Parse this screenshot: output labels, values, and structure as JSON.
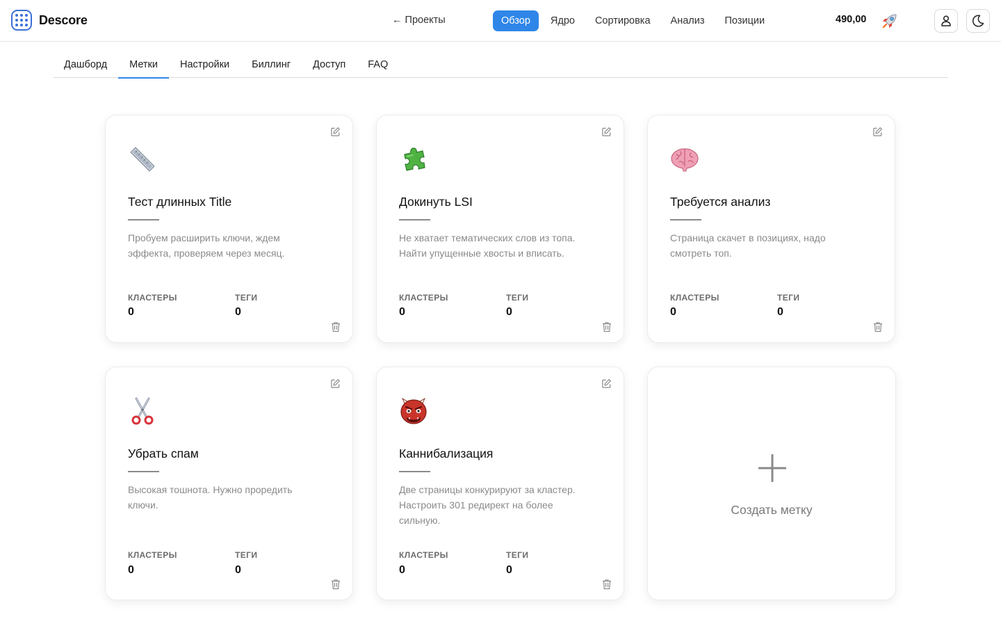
{
  "app": {
    "name": "Descore"
  },
  "header": {
    "back_label": "← Проекты",
    "nav": [
      {
        "label": "Обзор",
        "active": true
      },
      {
        "label": "Ядро",
        "active": false
      },
      {
        "label": "Сортировка",
        "active": false
      },
      {
        "label": "Анализ",
        "active": false
      },
      {
        "label": "Позиции",
        "active": false
      }
    ],
    "balance": "490,00",
    "balance_icon": "rocket-icon",
    "user_icon": "user-icon",
    "theme_icon": "moon-icon"
  },
  "tabs": [
    {
      "label": "Дашборд",
      "active": false
    },
    {
      "label": "Метки",
      "active": true
    },
    {
      "label": "Настройки",
      "active": false
    },
    {
      "label": "Биллинг",
      "active": false
    },
    {
      "label": "Доступ",
      "active": false
    },
    {
      "label": "FAQ",
      "active": false
    }
  ],
  "labels": [
    {
      "icon": "ruler-icon",
      "title": "Тест длинных Title",
      "description": "Пробуем расширить ключи, ждем эффекта, проверяем через месяц.",
      "clusters_label": "КЛАСТЕРЫ",
      "clusters": "0",
      "tags_label": "ТЕГИ",
      "tags": "0"
    },
    {
      "icon": "puzzle-piece-icon",
      "title": "Докинуть LSI",
      "description": "Не хватает тематических слов из топа. Найти упущенные хвосты и вписать.",
      "clusters_label": "КЛАСТЕРЫ",
      "clusters": "0",
      "tags_label": "ТЕГИ",
      "tags": "0"
    },
    {
      "icon": "brain-icon",
      "title": "Требуется анализ",
      "description": "Страница скачет в позициях, надо смотреть топ.",
      "clusters_label": "КЛАСТЕРЫ",
      "clusters": "0",
      "tags_label": "ТЕГИ",
      "tags": "0"
    },
    {
      "icon": "scissors-icon",
      "title": "Убрать спам",
      "description": "Высокая тошнота. Нужно проредить ключи.",
      "clusters_label": "КЛАСТЕРЫ",
      "clusters": "0",
      "tags_label": "ТЕГИ",
      "tags": "0"
    },
    {
      "icon": "ogre-icon",
      "title": "Каннибализация",
      "description": "Две страницы конкурируют за кластер. Настроить 301 редирект на более сильную.",
      "clusters_label": "КЛАСТЕРЫ",
      "clusters": "0",
      "tags_label": "ТЕГИ",
      "tags": "0"
    }
  ],
  "create_card": {
    "label": "Создать метку",
    "icon": "plus-icon"
  },
  "colors": {
    "accent": "#2f86e8",
    "logo": "#3b6fd8",
    "muted_text": "#8a8a8a"
  }
}
